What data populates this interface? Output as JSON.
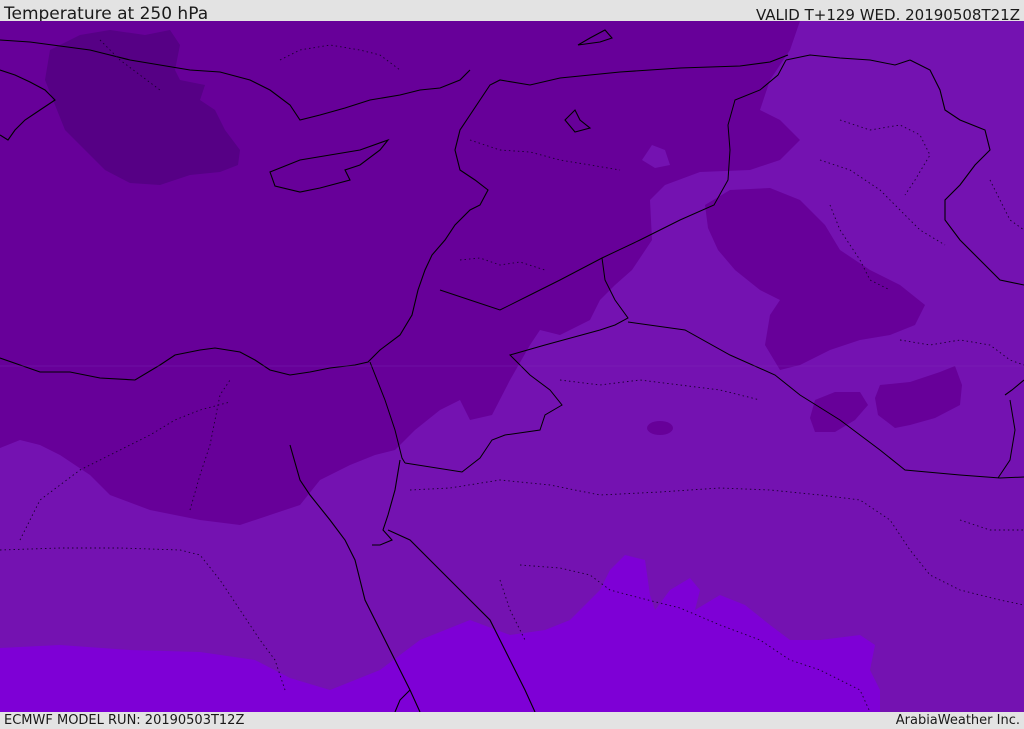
{
  "header": {
    "title": "Temperature at 250 hPa",
    "valid": "VALID T+129 WED. 20190508T21Z"
  },
  "footer": {
    "model_run": "ECMWF MODEL RUN: 20190503T12Z",
    "credit": "ArabiaWeather Inc."
  },
  "map": {
    "region": "Eastern Mediterranean and Middle East",
    "parameter": "Temperature",
    "level": "250 hPa",
    "colors": {
      "coldest": "#560085",
      "cold": "#670099",
      "mid": "#7412b1",
      "warm": "#7e00d6",
      "borders": "#000000",
      "frame": "#e3e3e3"
    }
  }
}
